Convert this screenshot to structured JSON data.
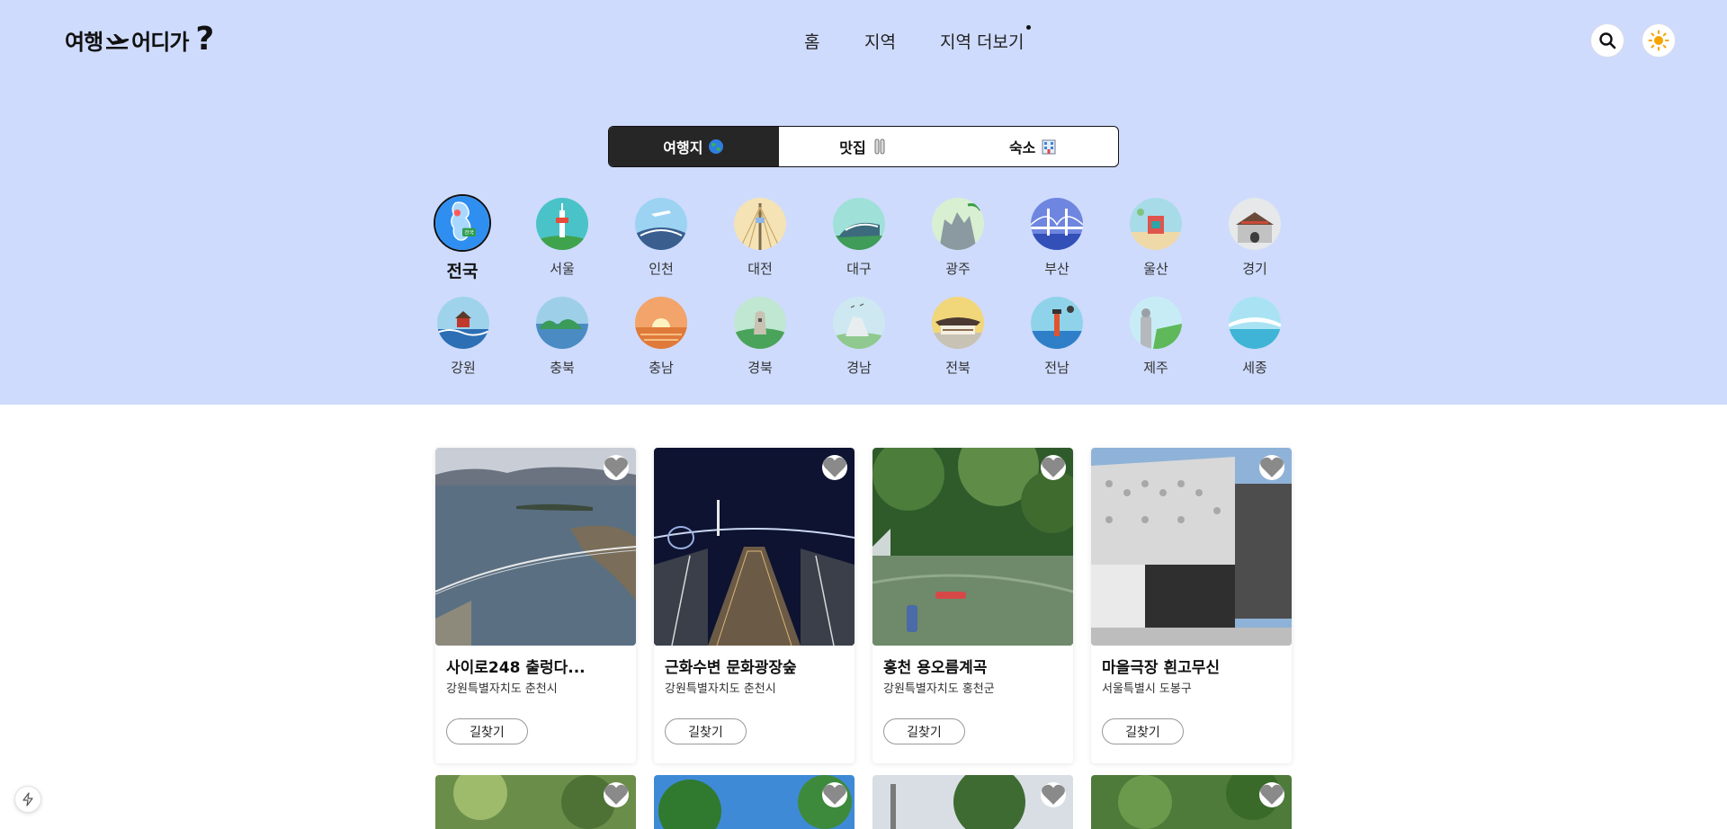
{
  "header": {
    "logo_main": "여행",
    "logo_rest": "어디가",
    "logo_q": "?",
    "nav": [
      "홈",
      "지역",
      "지역 더보기"
    ]
  },
  "tabs": [
    {
      "label": "여행지",
      "icon": "globe-icon",
      "active": true
    },
    {
      "label": "맛집",
      "icon": "utensils-icon",
      "active": false
    },
    {
      "label": "숙소",
      "icon": "hotel-icon",
      "active": false
    }
  ],
  "regions": {
    "row1": [
      "전국",
      "서울",
      "인천",
      "대전",
      "대구",
      "광주",
      "부산",
      "울산",
      "경기"
    ],
    "row2": [
      "강원",
      "충북",
      "충남",
      "경북",
      "경남",
      "전북",
      "전남",
      "제주",
      "세종"
    ],
    "selected": "전국",
    "map_badge": "전국"
  },
  "cards": [
    {
      "title": "사이로248 출렁다...",
      "address": "강원특별자치도 춘천시",
      "button": "길찾기"
    },
    {
      "title": "근화수변 문화광장숲",
      "address": "강원특별자치도 춘천시",
      "button": "길찾기"
    },
    {
      "title": "홍천 용오름계곡",
      "address": "강원특별자치도 홍천군",
      "button": "길찾기"
    },
    {
      "title": "마을극장 흰고무신",
      "address": "서울특별시 도봉구",
      "button": "길찾기"
    }
  ],
  "colors": {
    "hero_bg": "#cedbfd",
    "tab_active_bg": "#262626",
    "sun_icon": "#f5a300"
  }
}
